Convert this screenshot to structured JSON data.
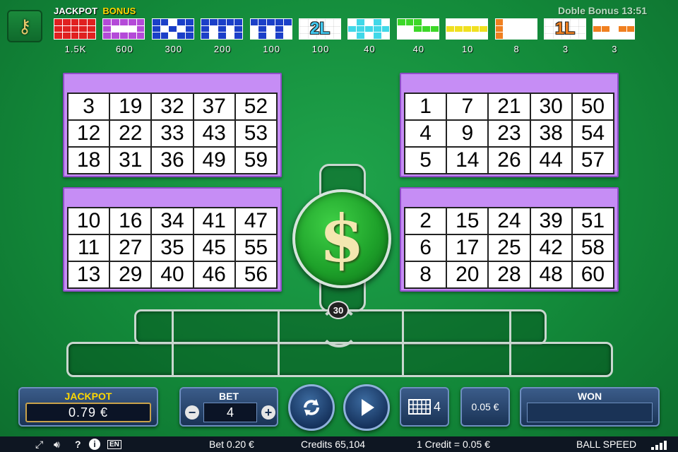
{
  "clock": "Doble Bonus 13:51",
  "paytable": [
    {
      "top": "JACKPOT",
      "top_color": "#ffffff",
      "value": "1.5K",
      "color": "#e02020",
      "cells": [
        1,
        1,
        1,
        1,
        1,
        1,
        1,
        1,
        1,
        1,
        1,
        1,
        1,
        1,
        1
      ]
    },
    {
      "top": "BONUS",
      "top_color": "#ffd800",
      "value": "600",
      "color": "#b44ad8",
      "cells": [
        1,
        1,
        1,
        1,
        1,
        1,
        0,
        0,
        0,
        1,
        1,
        1,
        1,
        1,
        1
      ]
    },
    {
      "top": "",
      "value": "300",
      "color": "#1b3fc8",
      "cells": [
        1,
        1,
        0,
        1,
        1,
        1,
        0,
        1,
        0,
        1,
        1,
        1,
        0,
        1,
        1
      ]
    },
    {
      "top": "",
      "value": "200",
      "color": "#1b3fc8",
      "cells": [
        1,
        1,
        1,
        1,
        1,
        1,
        0,
        1,
        0,
        1,
        1,
        0,
        1,
        0,
        1
      ]
    },
    {
      "top": "",
      "value": "100",
      "color": "#1b3fc8",
      "cells": [
        1,
        1,
        1,
        1,
        1,
        0,
        1,
        0,
        1,
        0,
        0,
        1,
        0,
        1,
        0
      ]
    },
    {
      "top": "",
      "value": "100",
      "color": "#40c8f0",
      "badge": "2L"
    },
    {
      "top": "",
      "value": "40",
      "color": "#40d8e8",
      "cells": [
        0,
        1,
        0,
        1,
        0,
        1,
        1,
        1,
        1,
        1,
        0,
        1,
        0,
        1,
        0
      ]
    },
    {
      "top": "",
      "value": "40",
      "color": "#3cd828",
      "cells": [
        1,
        1,
        1,
        0,
        0,
        0,
        0,
        1,
        1,
        1,
        0,
        0,
        0,
        0,
        0
      ]
    },
    {
      "top": "",
      "value": "10",
      "color": "#f0e020",
      "cells": [
        0,
        0,
        0,
        0,
        0,
        1,
        1,
        1,
        1,
        1,
        0,
        0,
        0,
        0,
        0
      ]
    },
    {
      "top": "",
      "value": "8",
      "color": "#f08020",
      "cells": [
        1,
        0,
        0,
        0,
        0,
        1,
        0,
        0,
        0,
        0,
        1,
        0,
        0,
        0,
        0
      ]
    },
    {
      "top": "",
      "value": "3",
      "color": "#f08020",
      "badge": "1L"
    },
    {
      "top": "",
      "value": "3",
      "color": "#f08020",
      "cells": [
        0,
        0,
        0,
        0,
        0,
        1,
        1,
        0,
        1,
        1,
        0,
        0,
        0,
        0,
        0
      ]
    }
  ],
  "cards": [
    [
      3,
      19,
      32,
      37,
      52,
      12,
      22,
      33,
      43,
      53,
      18,
      31,
      36,
      49,
      59
    ],
    [
      1,
      7,
      21,
      30,
      50,
      4,
      9,
      23,
      38,
      54,
      5,
      14,
      26,
      44,
      57
    ],
    [
      10,
      16,
      34,
      41,
      47,
      11,
      27,
      35,
      45,
      55,
      13,
      29,
      40,
      46,
      56
    ],
    [
      2,
      15,
      24,
      39,
      51,
      6,
      17,
      25,
      42,
      58,
      8,
      20,
      28,
      48,
      60
    ]
  ],
  "ball_symbol": "$",
  "ball_count": "30",
  "controls": {
    "jackpot_label": "JACKPOT",
    "jackpot_value": "0.79 €",
    "bet_label": "BET",
    "bet_value": "4",
    "minus": "−",
    "plus": "+",
    "cards_count": "4",
    "coin_value": "0.05 €",
    "won_label": "WON"
  },
  "status": {
    "bet": "Bet  0.20 €",
    "credits": "Credits  65,104",
    "credit_rate": "1 Credit =   0.05 €",
    "ball_speed": "BALL SPEED",
    "lang": "EN",
    "help": "?",
    "info": "i"
  },
  "icons": [
    "expand-icon",
    "sound-icon",
    "help-icon",
    "info-icon",
    "language-icon",
    "refresh-icon",
    "play-icon",
    "cards-grid-icon",
    "dollar-icon"
  ]
}
